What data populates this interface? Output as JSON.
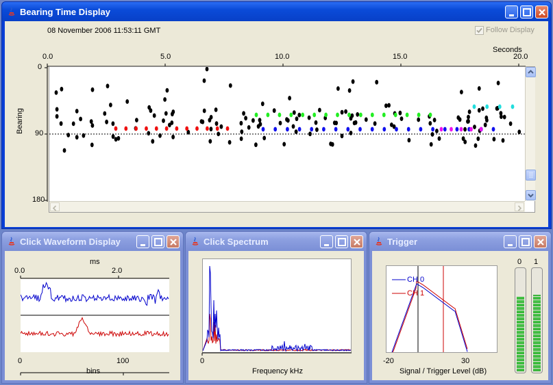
{
  "bearing_window": {
    "title": "Bearing Time Display",
    "timestamp": "08 November 2006 11:53:11 GMT",
    "follow_display_label": "Follow Display",
    "follow_display_checked": true,
    "x_unit": "Seconds",
    "x_ticks": [
      "0.0",
      "5.0",
      "10.0",
      "15.0",
      "20.0"
    ],
    "y_label": "Bearing",
    "y_ticks": [
      "0",
      "90",
      "180"
    ]
  },
  "waveform_window": {
    "title": "Click Waveform Display",
    "top_unit": "ms",
    "top_ticks": [
      "0.0",
      "2.0"
    ],
    "bottom_ticks": [
      "0",
      "100"
    ],
    "bottom_label": "bins"
  },
  "spectrum_window": {
    "title": "Click Spectrum",
    "x_ticks": [
      "0"
    ],
    "x_label": "Frequency kHz"
  },
  "trigger_window": {
    "title": "Trigger",
    "legend": [
      "CH 0",
      "CH 1"
    ],
    "x_ticks": [
      "-20",
      "30"
    ],
    "x_label": "Signal / Trigger Level (dB)",
    "meter_labels": [
      "0",
      "1"
    ],
    "meter_levels": [
      0.72,
      0.74
    ]
  },
  "colors": {
    "title_active": "#0a4bd8",
    "title_inactive": "#8c9fe0",
    "ch0": "#0000cc",
    "ch1": "#cc0000",
    "click_black": "#000000",
    "click_red": "#ee1111",
    "click_green": "#22ee22",
    "click_blue": "#1111ee",
    "click_magenta": "#ee11ee",
    "click_cyan": "#22dddd"
  }
}
